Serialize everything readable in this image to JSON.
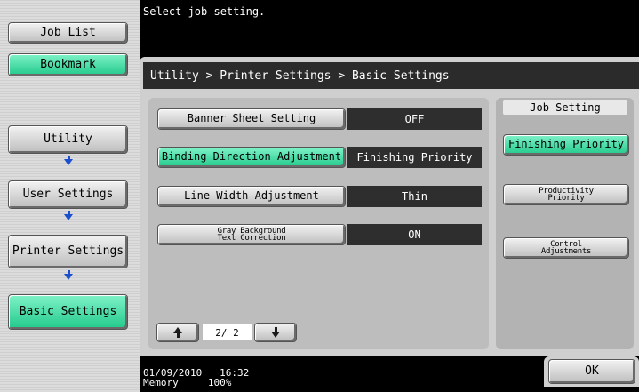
{
  "message": "Select job setting.",
  "breadcrumb": "Utility > Printer Settings > Basic Settings",
  "left_nav": {
    "job_list": "Job List",
    "bookmark": "Bookmark",
    "path": [
      "Utility",
      "User Settings",
      "Printer Settings",
      "Basic Settings"
    ]
  },
  "settings": [
    {
      "label": "Banner Sheet Setting",
      "value": "OFF",
      "active": false
    },
    {
      "label": "Binding Direction Adjustment",
      "value": "Finishing Priority",
      "active": true
    },
    {
      "label": "Line Width Adjustment",
      "value": "Thin",
      "active": false
    },
    {
      "label": "Gray Background\nText Correction",
      "value": "ON",
      "active": false
    }
  ],
  "pagination": {
    "page": "2/ 2"
  },
  "job_setting": {
    "title": "Job Setting",
    "options": [
      {
        "label": "Finishing Priority",
        "selected": true
      },
      {
        "label": "Productivity\nPriority",
        "selected": false
      },
      {
        "label": "Control\nAdjustments",
        "selected": false
      }
    ]
  },
  "footer": {
    "date": "01/09/2010",
    "time": "16:32",
    "memory_label": "Memory",
    "memory_value": "100%"
  },
  "ok_label": "OK",
  "colors": {
    "accent_green": "#22c98b",
    "dark": "#2e2e2e",
    "arrow_blue": "#1a4fd0"
  }
}
